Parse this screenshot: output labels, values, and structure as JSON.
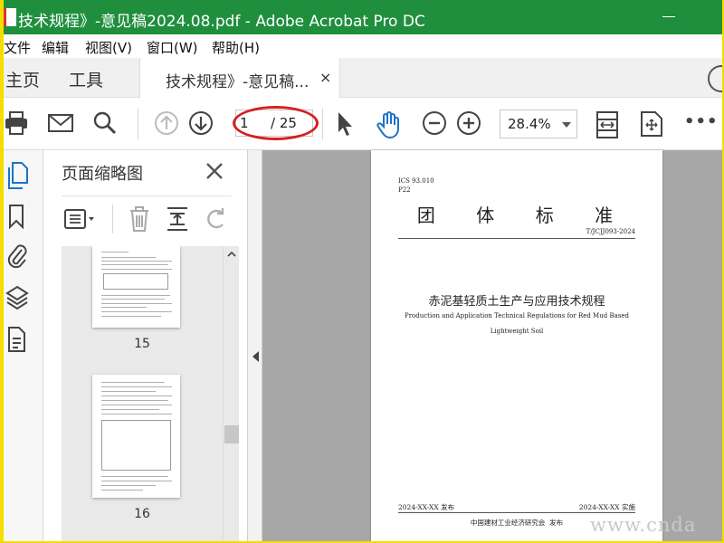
{
  "window": {
    "title": "技术规程》-意见稿2024.08.pdf - Adobe Acrobat Pro DC",
    "minimize_symbol": "—"
  },
  "menu": [
    "文件",
    "编辑",
    "视图(V)",
    "窗口(W)",
    "帮助(H)"
  ],
  "nav_tabs": {
    "home": "主页",
    "tools": "工具"
  },
  "doc_tab": {
    "label": "技术规程》-意见稿...",
    "close": "×"
  },
  "toolbar": {
    "page_current": "1",
    "page_total": "/ 25",
    "zoom": "28.4%",
    "more": "•••"
  },
  "sidebar_panel": {
    "title": "页面缩略图",
    "thumbnails": [
      {
        "page": "15"
      },
      {
        "page": "16"
      }
    ]
  },
  "document_page": {
    "ics": "ICS 93.010",
    "ccs": "P22",
    "category": "团    体    标    准",
    "number": "T/JCJJ093-2024",
    "title_cn": "赤泥基轻质土生产与应用技术规程",
    "title_en_line1": "Production and Application Technical Regulations for Red Mud Based",
    "title_en_line2": "Lightweight Soil",
    "publish_date": "2024-XX-XX 发布",
    "implement_date": "2024-XX-XX 实施",
    "publisher": "中国建材工业经济研究会  发布"
  },
  "watermark": "www.cnda",
  "colors": {
    "titlebar": "#1f8f3e",
    "accent_blue": "#1a73c9",
    "highlight_red": "#d62020"
  }
}
